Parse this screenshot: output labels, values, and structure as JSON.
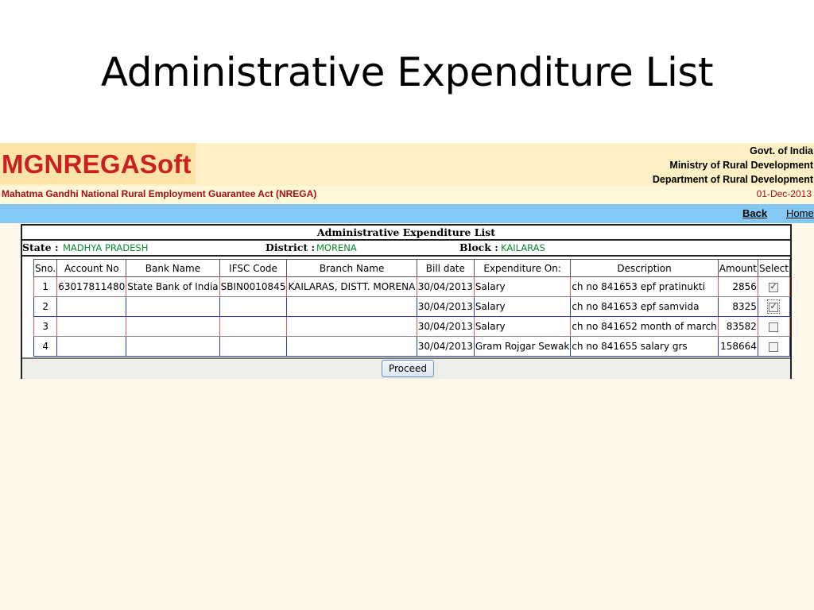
{
  "slide": {
    "title": "Administrative Expenditure List"
  },
  "header": {
    "logo": "MGNREGASoft",
    "govt_line1": "Govt. of India",
    "govt_line2": "Ministry of Rural Development",
    "govt_line3": "Department of Rural Development",
    "act_name": "Mahatma Gandhi National Rural Employment Guarantee Act (NREGA)",
    "date": "01-Dec-2013"
  },
  "nav": {
    "back": "Back",
    "home": "Home"
  },
  "panel": {
    "title": "Administrative Expenditure List",
    "state_label": "State :",
    "state_value": "MADHYA PRADESH",
    "district_label": "District :",
    "district_value": "MORENA",
    "block_label": "Block :",
    "block_value": "KAILARAS"
  },
  "table": {
    "headers": [
      "Sno.",
      "Account No",
      "Bank Name",
      "IFSC Code",
      "Branch Name",
      "Bill date",
      "Expenditure On:",
      "Description",
      "Amount",
      "Select"
    ],
    "rows": [
      {
        "sno": "1",
        "account": "63017811480",
        "bank": "State Bank of India",
        "ifsc": "SBIN0010845",
        "branch": "KAILARAS, DISTT. MORENA",
        "bill_date": "30/04/2013",
        "expenditure": "Salary",
        "description": "ch no 841653 epf pratinukti",
        "amount": "2856",
        "selected": true
      },
      {
        "sno": "2",
        "account": "",
        "bank": "",
        "ifsc": "",
        "branch": "",
        "bill_date": "30/04/2013",
        "expenditure": "Salary",
        "description": "ch no 841653 epf samvida",
        "amount": "8325",
        "selected": true
      },
      {
        "sno": "3",
        "account": "",
        "bank": "",
        "ifsc": "",
        "branch": "",
        "bill_date": "30/04/2013",
        "expenditure": "Salary",
        "description": "ch no 841652 month of march",
        "amount": "83582",
        "selected": false
      },
      {
        "sno": "4",
        "account": "",
        "bank": "",
        "ifsc": "",
        "branch": "",
        "bill_date": "30/04/2013",
        "expenditure": "Gram Rojgar Sewak",
        "description": "ch no 841655 salary grs",
        "amount": "158664",
        "selected": false
      }
    ]
  },
  "actions": {
    "proceed": "Proceed"
  }
}
